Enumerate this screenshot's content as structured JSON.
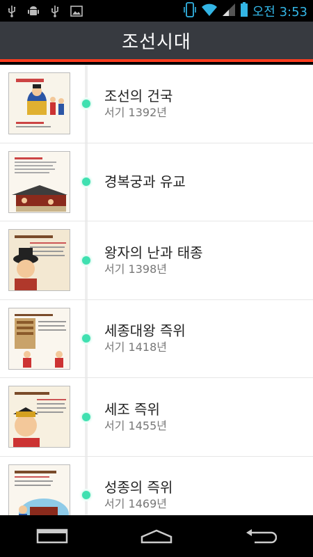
{
  "status_bar": {
    "icons": [
      "usb-icon",
      "android-debug-icon",
      "usb-icon",
      "image-icon"
    ],
    "right_icons": [
      "vibrate-icon",
      "wifi-icon",
      "signal-icon",
      "battery-icon"
    ],
    "time": "오전 3:53",
    "accent_color": "#33b5e5"
  },
  "header": {
    "title": "조선시대",
    "background": "#373a40",
    "accent_line": "#ff3c1f"
  },
  "items": [
    {
      "title": "조선의 건국",
      "year": "서기 1392년"
    },
    {
      "title": "경복궁과 유교",
      "year": ""
    },
    {
      "title": "왕자의 난과 태종",
      "year": "서기 1398년"
    },
    {
      "title": "세종대왕 즉위",
      "year": "서기 1418년"
    },
    {
      "title": "세조 즉위",
      "year": "서기 1455년"
    },
    {
      "title": "성종의 즉위",
      "year": "서기 1469년"
    }
  ],
  "nav_bar": {
    "buttons": [
      "back-icon",
      "home-icon",
      "recent-apps-icon"
    ]
  }
}
